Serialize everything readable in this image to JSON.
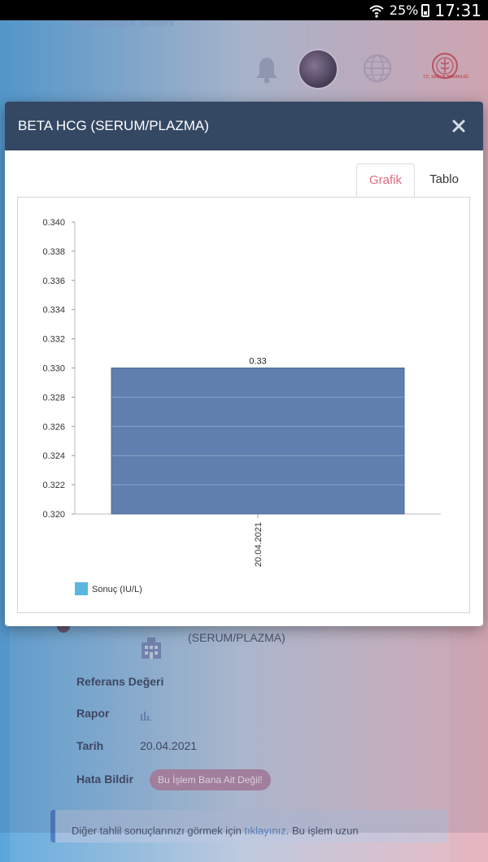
{
  "status_bar": {
    "battery": "25%",
    "time": "17:31"
  },
  "app": {
    "subtitle": "Kişisel Sağlık Sistemi",
    "ministry_label": "T.C. SAĞLIK BAKANLIĞI"
  },
  "modal": {
    "title": "BETA HCG (SERUM/PLAZMA)",
    "tabs": [
      {
        "label": "Grafik",
        "active": true
      },
      {
        "label": "Tablo",
        "active": false
      }
    ]
  },
  "chart_data": {
    "type": "bar",
    "categories": [
      "20.04.2021"
    ],
    "series": [
      {
        "name": "Sonuç (IU/L)",
        "values": [
          0.33
        ],
        "color": "#5f7fae"
      }
    ],
    "data_labels": [
      "0.33"
    ],
    "ylim": [
      0.32,
      0.34
    ],
    "yticks": [
      "0.340",
      "0.338",
      "0.336",
      "0.334",
      "0.332",
      "0.330",
      "0.328",
      "0.326",
      "0.324",
      "0.322",
      "0.320"
    ],
    "legend_position": "bottom-left",
    "legend_swatch_color": "#5bb6e0",
    "grid": false
  },
  "background": {
    "test_name_tail": "(SERUM/PLAZMA)",
    "fields": [
      {
        "label": "Referans Değeri",
        "value": ""
      },
      {
        "label": "Rapor",
        "value": ""
      },
      {
        "label": "Tarih",
        "value": "20.04.2021"
      },
      {
        "label": "Hata Bildir",
        "value": ""
      }
    ],
    "error_button": "Bu İşlem Bana Ait Değil!",
    "info_prefix": "Diğer tahlil sonuçlarınızı görmek için ",
    "info_link": "tıklayınız",
    "info_suffix": ". Bu işlem uzun"
  }
}
